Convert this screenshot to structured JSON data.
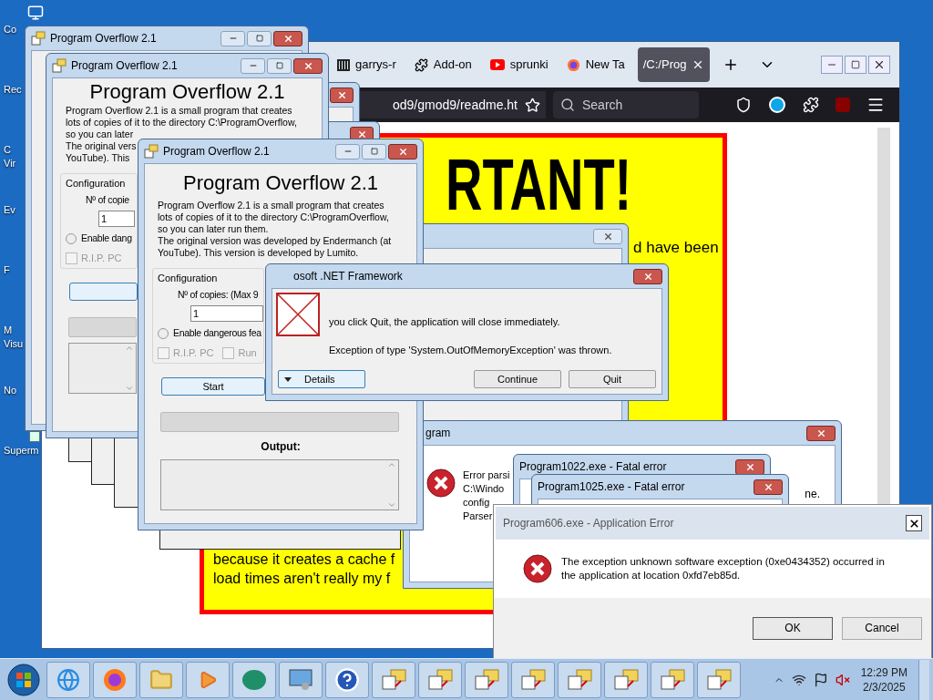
{
  "desktop": {
    "icons": [
      {
        "kind": "computer",
        "lines": [
          "Co"
        ]
      },
      {
        "kind": "label_only",
        "lines": [
          "Rec"
        ]
      },
      {
        "kind": "label_only",
        "lines": [
          "C",
          "Vir"
        ]
      },
      {
        "kind": "label_only",
        "lines": [
          "Ev"
        ]
      },
      {
        "kind": "label_only",
        "lines": [
          "F"
        ]
      },
      {
        "kind": "label_only",
        "lines": [
          "M",
          "Visu"
        ]
      },
      {
        "kind": "label_only",
        "lines": [
          "No"
        ]
      },
      {
        "kind": "shortcut",
        "lines": [
          "Superm"
        ]
      }
    ]
  },
  "browser": {
    "tabs": [
      {
        "kind": "gmod",
        "label": "garrys-r",
        "selected": false
      },
      {
        "kind": "addon",
        "label": "Add-on",
        "selected": false
      },
      {
        "kind": "youtube",
        "label": "sprunki",
        "selected": false
      },
      {
        "kind": "firefox",
        "label": "New Ta",
        "selected": false
      },
      {
        "kind": "file",
        "label": "/C:/Prog",
        "selected": true
      }
    ],
    "address": "od9/gmod9/readme.ht",
    "search": {
      "placeholder": "Search"
    },
    "page": {
      "heading": "RTANT!",
      "side_line": "d have been",
      "lines": [
        "because it creates a cache f",
        "load times aren't really my f"
      ]
    }
  },
  "program_windows": [
    {
      "title": "Program Overflow 2.1"
    },
    {
      "title": "Program Overflow 2.1",
      "heading": "Program Overflow 2.1",
      "description": [
        "Program Overflow 2.1 is a small program that creates",
        "lots of copies of it to the directory C:\\ProgramOverflow,",
        "so you can later",
        "The original vers",
        "YouTube). This"
      ],
      "config_label": "Configuration",
      "copies_label": "Nº of copie",
      "copies_value": "1",
      "dangerous": {
        "label": "Enable dang",
        "selected": false
      },
      "options": [
        {
          "label": "R.I.P. PC",
          "checked": false,
          "disabled": true
        }
      ],
      "progress": {
        "level": 0
      }
    },
    {
      "title": "Program Overflow 2.1",
      "heading": "Program Overflow 2.1",
      "description": [
        "Program Overflow 2.1 is a small program that creates",
        "lots of copies of it to the directory C:\\ProgramOverflow,",
        "so you can later run them.",
        "The original version was developed by Endermanch (at",
        "YouTube). This version is developed by Lumito."
      ],
      "config_label": "Configuration",
      "copies_label": "Nº of copies: (Max 9",
      "copies_value": "1",
      "dangerous": {
        "label": "Enable dangerous fea",
        "selected": false
      },
      "options": [
        {
          "label": "R.I.P. PC",
          "checked": false,
          "disabled": true
        },
        {
          "label": "Run",
          "checked": false,
          "disabled": true
        }
      ],
      "start_button": "Start",
      "progress": {
        "level": 0
      },
      "output_label": "Output:"
    }
  ],
  "dotnet_dialog": {
    "title": "osoft .NET Framework",
    "message": "you click Quit, the application will close immediately.",
    "exception": "Exception of type 'System.OutOfMemoryException' was thrown.",
    "buttons": [
      {
        "kind": "expand",
        "label": "Details"
      },
      {
        "kind": "plain",
        "label": "Continue"
      },
      {
        "kind": "plain",
        "label": "Quit"
      }
    ]
  },
  "parser_error": {
    "title": "gram",
    "lines": [
      "Error parsi",
      "C:\\Windo",
      "config",
      "Parser"
    ],
    "tail": "ne."
  },
  "fatal_errors": [
    {
      "title": "Program1022.exe - Fatal error"
    },
    {
      "title": "Program1025.exe - Fatal error"
    }
  ],
  "app_error": {
    "title": "Program606.exe - Application Error",
    "message": "The exception unknown software exception (0xe0434352) occurred in the application at location 0xfd7eb85d.",
    "buttons": [
      "OK",
      "Cancel"
    ]
  },
  "taskbar": {
    "pinned": [
      {
        "kind": "ie"
      },
      {
        "kind": "firefox"
      },
      {
        "kind": "folder"
      },
      {
        "kind": "media"
      },
      {
        "kind": "green"
      },
      {
        "kind": "control"
      },
      {
        "kind": "help"
      }
    ],
    "programs": [
      {
        "kind": "program"
      },
      {
        "kind": "program"
      },
      {
        "kind": "program"
      },
      {
        "kind": "program"
      },
      {
        "kind": "program"
      },
      {
        "kind": "program"
      },
      {
        "kind": "program"
      },
      {
        "kind": "program"
      }
    ],
    "volume": {
      "muted": true
    },
    "time": "12:29 PM",
    "date": "2/3/2025"
  }
}
